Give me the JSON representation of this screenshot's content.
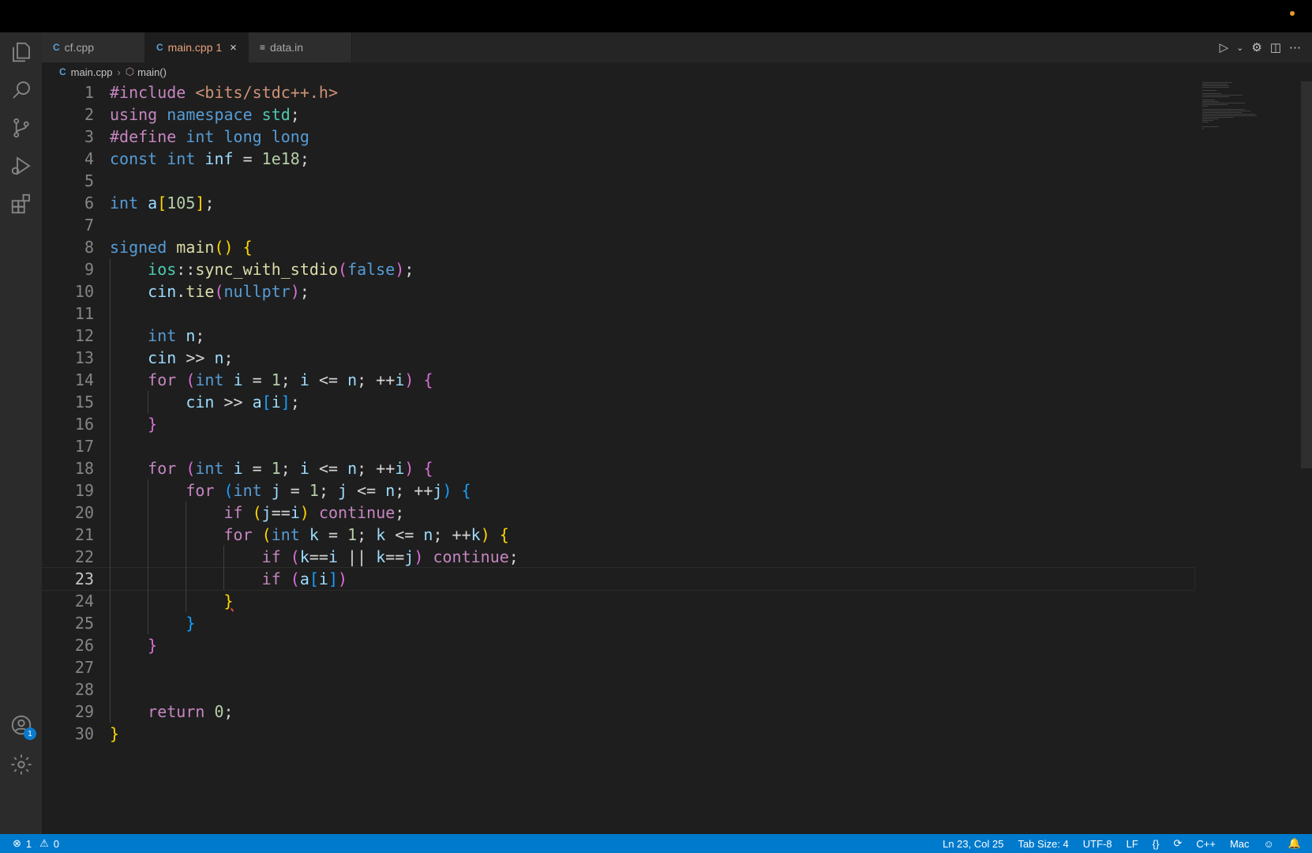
{
  "tabs": [
    {
      "label": "cf.cpp",
      "icon": "cpp-file-icon"
    },
    {
      "label": "main.cpp 1",
      "icon": "cpp-file-icon",
      "active": true
    },
    {
      "label": "data.in",
      "icon": "text-file-icon"
    }
  ],
  "close_glyph": "×",
  "breadcrumb": {
    "file": "main.cpp",
    "symbol": "main()"
  },
  "code": {
    "current_line": 23,
    "lines": [
      [
        [
          "k-pre",
          "#include "
        ],
        [
          "k-str",
          "<bits/stdc++.h>"
        ]
      ],
      [
        [
          "k-ctl",
          "using "
        ],
        [
          "k-kw",
          "namespace "
        ],
        [
          "k-ns",
          "std"
        ],
        [
          "k-plain",
          ";"
        ]
      ],
      [
        [
          "k-pre",
          "#define "
        ],
        [
          "k-kw",
          "int long long"
        ]
      ],
      [
        [
          "k-kw",
          "const int "
        ],
        [
          "k-id",
          "inf"
        ],
        [
          "k-plain",
          " = "
        ],
        [
          "k-num",
          "1e18"
        ],
        [
          "k-plain",
          ";"
        ]
      ],
      [],
      [
        [
          "k-kw",
          "int "
        ],
        [
          "k-id",
          "a"
        ],
        [
          "k-b1",
          "["
        ],
        [
          "k-num",
          "105"
        ],
        [
          "k-b1",
          "]"
        ],
        [
          "k-plain",
          ";"
        ]
      ],
      [],
      [
        [
          "k-kw",
          "signed "
        ],
        [
          "k-fn",
          "main"
        ],
        [
          "k-b1",
          "() {"
        ]
      ],
      [
        [
          "k-plain",
          "    "
        ],
        [
          "k-ns",
          "ios"
        ],
        [
          "k-plain",
          "::"
        ],
        [
          "k-fn",
          "sync_with_stdio"
        ],
        [
          "k-b2",
          "("
        ],
        [
          "k-kw",
          "false"
        ],
        [
          "k-b2",
          ")"
        ],
        [
          "k-plain",
          ";"
        ]
      ],
      [
        [
          "k-plain",
          "    "
        ],
        [
          "k-id",
          "cin"
        ],
        [
          "k-plain",
          "."
        ],
        [
          "k-fn",
          "tie"
        ],
        [
          "k-b2",
          "("
        ],
        [
          "k-kw",
          "nullptr"
        ],
        [
          "k-b2",
          ")"
        ],
        [
          "k-plain",
          ";"
        ]
      ],
      [],
      [
        [
          "k-plain",
          "    "
        ],
        [
          "k-kw",
          "int "
        ],
        [
          "k-id",
          "n"
        ],
        [
          "k-plain",
          ";"
        ]
      ],
      [
        [
          "k-plain",
          "    "
        ],
        [
          "k-id",
          "cin"
        ],
        [
          "k-plain",
          " >> "
        ],
        [
          "k-id",
          "n"
        ],
        [
          "k-plain",
          ";"
        ]
      ],
      [
        [
          "k-plain",
          "    "
        ],
        [
          "k-ctl",
          "for "
        ],
        [
          "k-b2",
          "("
        ],
        [
          "k-kw",
          "int "
        ],
        [
          "k-id",
          "i"
        ],
        [
          "k-plain",
          " = "
        ],
        [
          "k-num",
          "1"
        ],
        [
          "k-plain",
          "; "
        ],
        [
          "k-id",
          "i"
        ],
        [
          "k-plain",
          " <= "
        ],
        [
          "k-id",
          "n"
        ],
        [
          "k-plain",
          "; ++"
        ],
        [
          "k-id",
          "i"
        ],
        [
          "k-b2",
          ") {"
        ]
      ],
      [
        [
          "k-plain",
          "        "
        ],
        [
          "k-id",
          "cin"
        ],
        [
          "k-plain",
          " >> "
        ],
        [
          "k-id",
          "a"
        ],
        [
          "k-b3",
          "["
        ],
        [
          "k-id",
          "i"
        ],
        [
          "k-b3",
          "]"
        ],
        [
          "k-plain",
          ";"
        ]
      ],
      [
        [
          "k-plain",
          "    "
        ],
        [
          "k-b2",
          "}"
        ]
      ],
      [],
      [
        [
          "k-plain",
          "    "
        ],
        [
          "k-ctl",
          "for "
        ],
        [
          "k-b2",
          "("
        ],
        [
          "k-kw",
          "int "
        ],
        [
          "k-id",
          "i"
        ],
        [
          "k-plain",
          " = "
        ],
        [
          "k-num",
          "1"
        ],
        [
          "k-plain",
          "; "
        ],
        [
          "k-id",
          "i"
        ],
        [
          "k-plain",
          " <= "
        ],
        [
          "k-id",
          "n"
        ],
        [
          "k-plain",
          "; ++"
        ],
        [
          "k-id",
          "i"
        ],
        [
          "k-b2",
          ") {"
        ]
      ],
      [
        [
          "k-plain",
          "        "
        ],
        [
          "k-ctl",
          "for "
        ],
        [
          "k-b3",
          "("
        ],
        [
          "k-kw",
          "int "
        ],
        [
          "k-id",
          "j"
        ],
        [
          "k-plain",
          " = "
        ],
        [
          "k-num",
          "1"
        ],
        [
          "k-plain",
          "; "
        ],
        [
          "k-id",
          "j"
        ],
        [
          "k-plain",
          " <= "
        ],
        [
          "k-id",
          "n"
        ],
        [
          "k-plain",
          "; ++"
        ],
        [
          "k-id",
          "j"
        ],
        [
          "k-b3",
          ") {"
        ]
      ],
      [
        [
          "k-plain",
          "            "
        ],
        [
          "k-ctl",
          "if "
        ],
        [
          "k-b1",
          "("
        ],
        [
          "k-id",
          "j"
        ],
        [
          "k-plain",
          "=="
        ],
        [
          "k-id",
          "i"
        ],
        [
          "k-b1",
          ")"
        ],
        [
          "k-ctl",
          " continue"
        ],
        [
          "k-plain",
          ";"
        ]
      ],
      [
        [
          "k-plain",
          "            "
        ],
        [
          "k-ctl",
          "for "
        ],
        [
          "k-b1",
          "("
        ],
        [
          "k-kw",
          "int "
        ],
        [
          "k-id",
          "k"
        ],
        [
          "k-plain",
          " = "
        ],
        [
          "k-num",
          "1"
        ],
        [
          "k-plain",
          "; "
        ],
        [
          "k-id",
          "k"
        ],
        [
          "k-plain",
          " <= "
        ],
        [
          "k-id",
          "n"
        ],
        [
          "k-plain",
          "; ++"
        ],
        [
          "k-id",
          "k"
        ],
        [
          "k-b1",
          ") {"
        ]
      ],
      [
        [
          "k-plain",
          "                "
        ],
        [
          "k-ctl",
          "if "
        ],
        [
          "k-b2",
          "("
        ],
        [
          "k-id",
          "k"
        ],
        [
          "k-plain",
          "=="
        ],
        [
          "k-id",
          "i"
        ],
        [
          "k-plain",
          " || "
        ],
        [
          "k-id",
          "k"
        ],
        [
          "k-plain",
          "=="
        ],
        [
          "k-id",
          "j"
        ],
        [
          "k-b2",
          ")"
        ],
        [
          "k-ctl",
          " continue"
        ],
        [
          "k-plain",
          ";"
        ]
      ],
      [
        [
          "k-plain",
          "                "
        ],
        [
          "k-ctl",
          "if "
        ],
        [
          "k-b2",
          "("
        ],
        [
          "k-id",
          "a"
        ],
        [
          "k-b3",
          "["
        ],
        [
          "k-id",
          "i"
        ],
        [
          "k-b3",
          "]"
        ],
        [
          "k-b2",
          ")"
        ]
      ],
      [
        [
          "k-plain",
          "            "
        ],
        [
          "k-b1 squig",
          "}"
        ]
      ],
      [
        [
          "k-plain",
          "        "
        ],
        [
          "k-b3",
          "}"
        ]
      ],
      [
        [
          "k-plain",
          "    "
        ],
        [
          "k-b2",
          "}"
        ]
      ],
      [],
      [],
      [
        [
          "k-plain",
          "    "
        ],
        [
          "k-ctl",
          "return "
        ],
        [
          "k-num",
          "0"
        ],
        [
          "k-plain",
          ";"
        ]
      ],
      [
        [
          "k-b1",
          "}"
        ]
      ]
    ]
  },
  "status": {
    "errors": "1",
    "warnings": "0",
    "position": "Ln 23, Col 25",
    "tab_size": "Tab Size: 4",
    "encoding": "UTF-8",
    "eol": "LF",
    "language": "C++",
    "platform": "Mac"
  },
  "accounts_badge": "1",
  "colors": {
    "accent": "#007acc",
    "active_tab_text": "#e7a37c"
  }
}
